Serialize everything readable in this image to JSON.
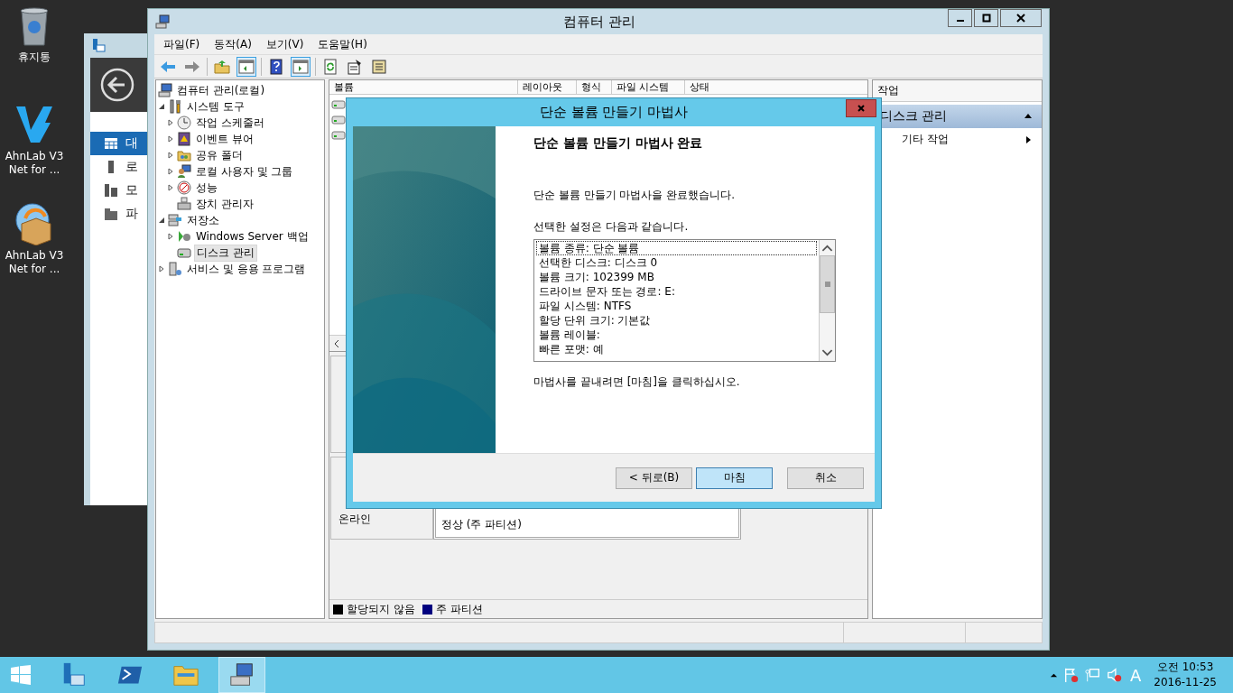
{
  "desktop_icons": [
    {
      "label": "휴지통",
      "kind": "recycle-bin"
    },
    {
      "label": "AhnLab V3 Net for ...",
      "kind": "v3"
    },
    {
      "label": "AhnLab V3 Net for ...",
      "kind": "package"
    }
  ],
  "server_manager": {
    "nav": [
      {
        "label": "대",
        "kind": "dashboard",
        "selected": true
      },
      {
        "label": "로",
        "kind": "server",
        "selected": false
      },
      {
        "label": "모",
        "kind": "servers",
        "selected": false
      },
      {
        "label": "파",
        "kind": "files",
        "selected": false
      }
    ]
  },
  "main_window": {
    "title": "컴퓨터 관리",
    "menu": [
      "파일(F)",
      "동작(A)",
      "보기(V)",
      "도움말(H)"
    ],
    "toolbar": [
      {
        "kind": "back",
        "pressed": false
      },
      {
        "kind": "forward",
        "pressed": false
      },
      {
        "kind": "separator"
      },
      {
        "kind": "up-folder",
        "pressed": false
      },
      {
        "kind": "tree-toggle",
        "pressed": true
      },
      {
        "kind": "separator"
      },
      {
        "kind": "help",
        "pressed": false
      },
      {
        "kind": "pane-toggle",
        "pressed": true
      },
      {
        "kind": "separator"
      },
      {
        "kind": "refresh",
        "pressed": false
      },
      {
        "kind": "properties",
        "pressed": false
      },
      {
        "kind": "export",
        "pressed": false
      }
    ],
    "tree": [
      {
        "label": "컴퓨터 관리(로컬)",
        "kind": "root",
        "selected": false,
        "children": [
          {
            "label": "시스템 도구",
            "kind": "branch",
            "expanded": true,
            "selected": false,
            "children": [
              {
                "label": "작업 스케줄러",
                "kind": "branch",
                "expanded": false,
                "selected": false
              },
              {
                "label": "이벤트 뷰어",
                "kind": "branch",
                "expanded": false,
                "selected": false
              },
              {
                "label": "공유 폴더",
                "kind": "branch",
                "expanded": false,
                "selected": false
              },
              {
                "label": "로컬 사용자 및 그룹",
                "kind": "branch",
                "expanded": false,
                "selected": false
              },
              {
                "label": "성능",
                "kind": "branch",
                "expanded": false,
                "selected": false
              },
              {
                "label": "장치 관리자",
                "kind": "leaf",
                "selected": false
              }
            ]
          },
          {
            "label": "저장소",
            "kind": "branch",
            "expanded": true,
            "selected": false,
            "children": [
              {
                "label": "Windows Server 백업",
                "kind": "branch",
                "expanded": false,
                "selected": false
              },
              {
                "label": "디스크 관리",
                "kind": "leaf",
                "selected": true
              }
            ]
          },
          {
            "label": "서비스 및 응용 프로그램",
            "kind": "branch",
            "expanded": false,
            "selected": false
          }
        ]
      }
    ],
    "volume_columns": [
      "볼륨",
      "레이아웃",
      "형식",
      "파일 시스템",
      "상태"
    ],
    "disk_rows": [
      {
        "status": "온라인",
        "partition_status": "정상 (주 파티션)"
      }
    ],
    "legend": [
      {
        "label": "할당되지 않음",
        "color": "#000000"
      },
      {
        "label": "주 파티션",
        "color": "#00007f"
      }
    ],
    "actions": {
      "header": "작업",
      "section": "디스크 관리",
      "section_expanded": true,
      "items": [
        {
          "label": "기타 작업",
          "kind": "submenu"
        }
      ]
    }
  },
  "wizard": {
    "title": "단순 볼륨 만들기 마법사",
    "heading": "단순 볼륨 만들기 마법사 완료",
    "intro": "단순 볼륨 만들기 마법사을 완료했습니다.",
    "settings_label": "선택한 설정은 다음과 같습니다.",
    "settings": [
      {
        "text": "볼륨 종류: 단순 볼륨",
        "focused": true
      },
      {
        "text": "선택한 디스크: 디스크 0",
        "focused": false
      },
      {
        "text": "볼륨 크기: 102399 MB",
        "focused": false
      },
      {
        "text": "드라이브 문자 또는 경로: E:",
        "focused": false
      },
      {
        "text": "파일 시스템: NTFS",
        "focused": false
      },
      {
        "text": "할당 단위 크기: 기본값",
        "focused": false
      },
      {
        "text": "볼륨 레이블:",
        "focused": false
      },
      {
        "text": "빠른 포맷: 예",
        "focused": false
      }
    ],
    "footer": "마법사를 끝내려면 [마침]을 클릭하십시오.",
    "buttons": [
      {
        "label": "< 뒤로(B)",
        "default": false
      },
      {
        "label": "마침",
        "default": true
      },
      {
        "label": "취소",
        "default": false
      }
    ]
  },
  "taskbar": {
    "apps": [
      {
        "kind": "server-manager",
        "selected": false
      },
      {
        "kind": "powershell",
        "selected": false
      },
      {
        "kind": "file-explorer",
        "selected": false
      },
      {
        "kind": "computer-management",
        "selected": true
      }
    ],
    "input_indicator": "A",
    "time": "오전 10:53",
    "date": "2016-11-25"
  }
}
